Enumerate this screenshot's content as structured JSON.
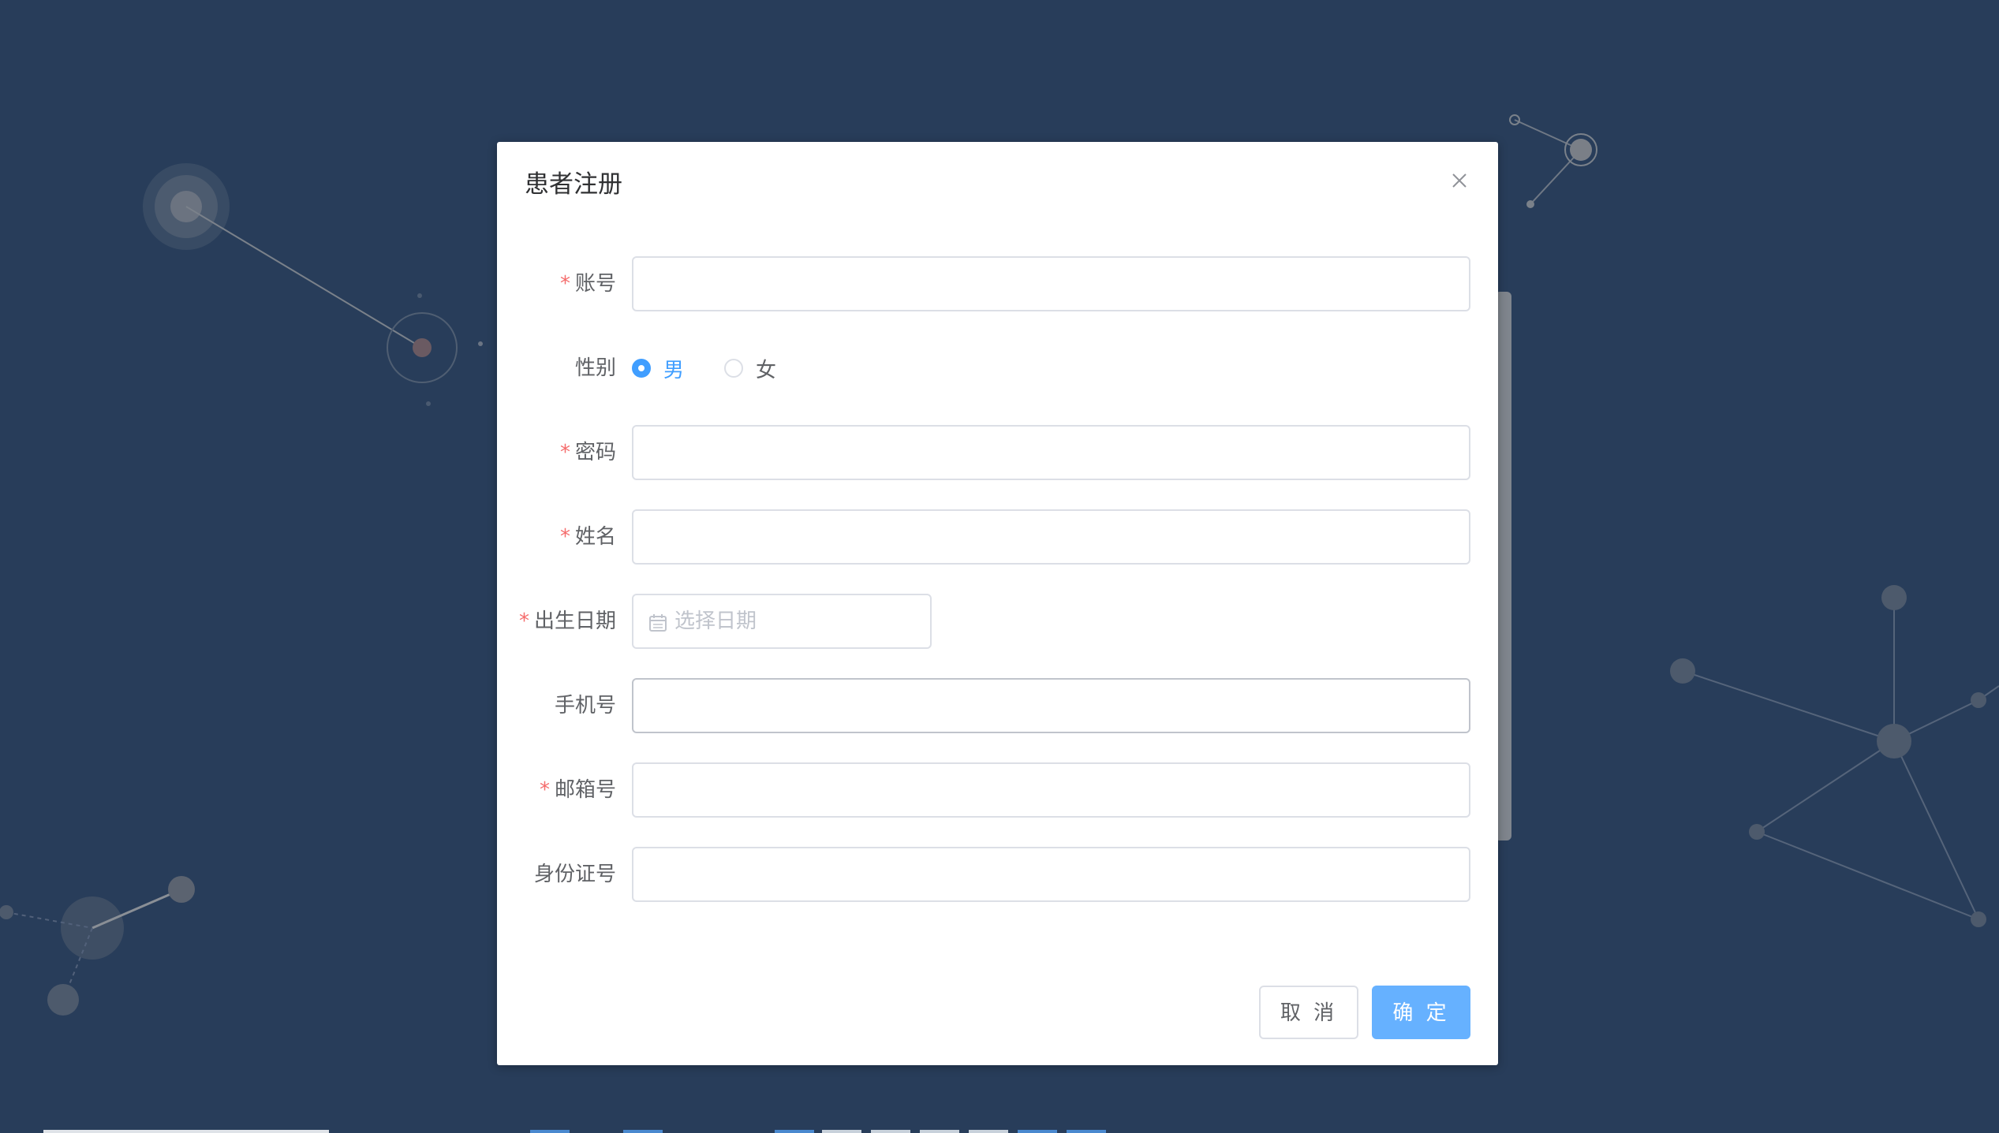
{
  "dialog": {
    "title": "患者注册",
    "close_icon": "close-icon"
  },
  "form": {
    "account": {
      "label": "账号",
      "required": true,
      "value": ""
    },
    "gender": {
      "label": "性别",
      "options": [
        {
          "label": "男",
          "checked": true
        },
        {
          "label": "女",
          "checked": false
        }
      ]
    },
    "password": {
      "label": "密码",
      "required": true,
      "value": ""
    },
    "name": {
      "label": "姓名",
      "required": true,
      "value": ""
    },
    "birthdate": {
      "label": "出生日期",
      "required": true,
      "placeholder": "选择日期",
      "icon": "calendar-icon"
    },
    "phone": {
      "label": "手机号",
      "required": false,
      "value": ""
    },
    "email": {
      "label": "邮箱号",
      "required": true,
      "value": ""
    },
    "id_card": {
      "label": "身份证号",
      "required": false,
      "value": ""
    },
    "required_mark": "*"
  },
  "buttons": {
    "cancel": "取 消",
    "confirm": "确 定"
  },
  "colors": {
    "background": "#283d5a",
    "primary": "#409eff",
    "confirm_button": "#66b1ff",
    "required": "#f56c6c"
  }
}
